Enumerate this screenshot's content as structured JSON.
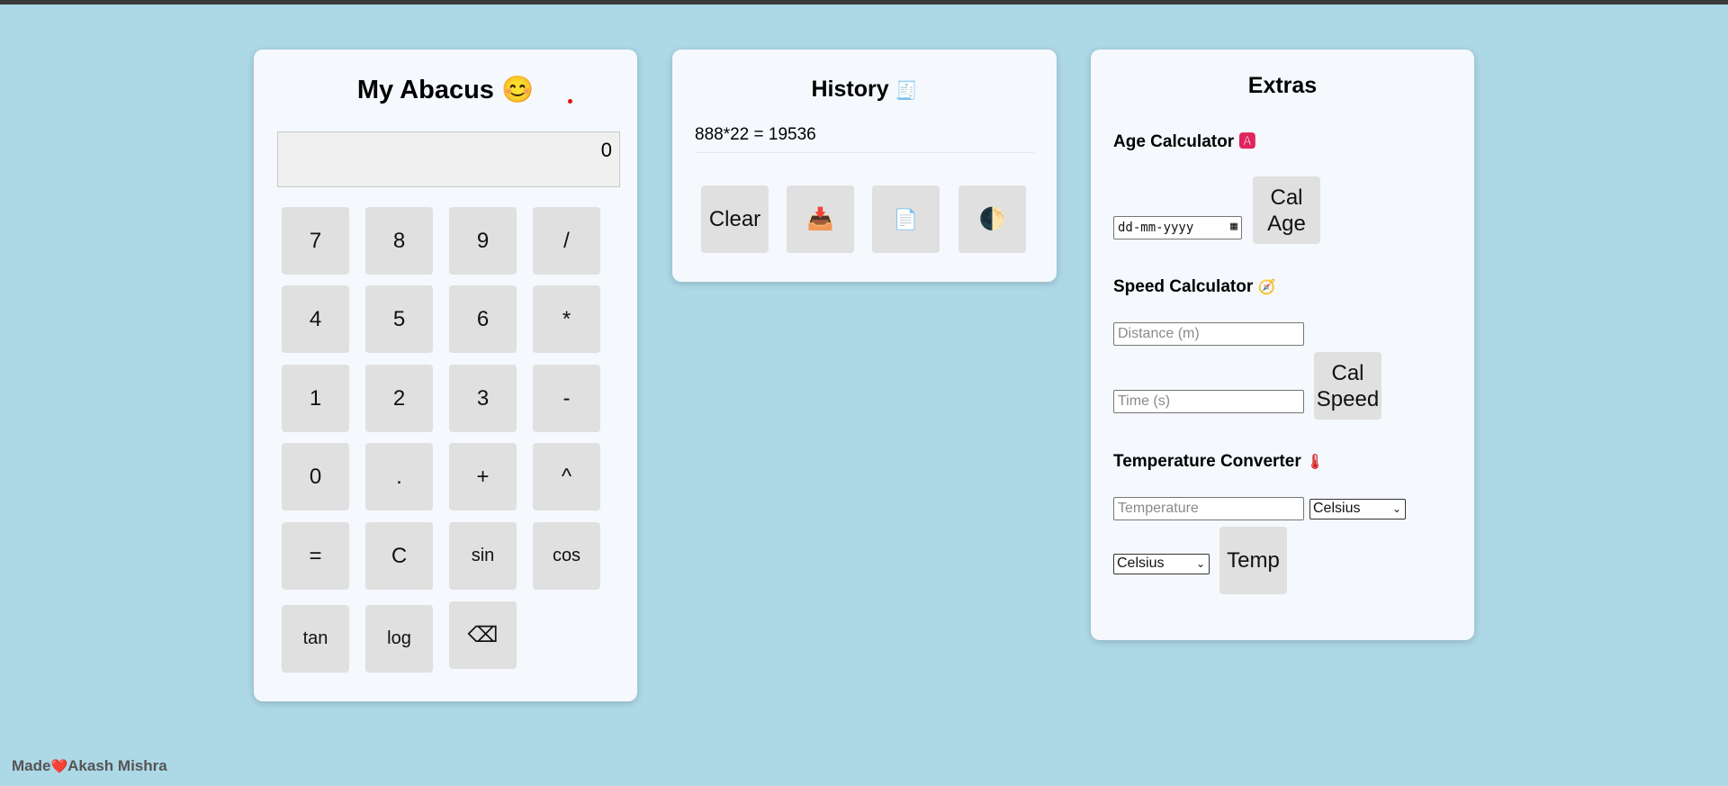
{
  "calculator": {
    "title": "My Abacus",
    "title_emoji": "😊",
    "display_value": "0",
    "keys": [
      "7",
      "8",
      "9",
      "/",
      "4",
      "5",
      "6",
      "*",
      "1",
      "2",
      "3",
      "-",
      "0",
      ".",
      "+",
      "^",
      "=",
      "C",
      "sin",
      "cos",
      "tan",
      "log",
      "⌫"
    ]
  },
  "history": {
    "title": "History",
    "title_icon": "🧾",
    "entries": [
      "888*22 = 19536"
    ],
    "clear_label": "Clear",
    "download_icon": "📥",
    "document_icon": "📄",
    "theme_icon": "🌓"
  },
  "extras": {
    "title": "Extras",
    "age": {
      "title": "Age Calculator",
      "icon": "🅰",
      "date_placeholder": "dd-mm-yyyy",
      "button": "Cal Age"
    },
    "speed": {
      "title": "Speed Calculator",
      "icon": "🧭",
      "distance_placeholder": "Distance (m)",
      "time_placeholder": "Time (s)",
      "button": "Cal Speed"
    },
    "temp": {
      "title": "Temperature Converter",
      "icon": "🌡",
      "input_placeholder": "Temperature",
      "from_unit": "Celsius",
      "to_unit": "Celsius",
      "button": "Temp"
    }
  },
  "footer": {
    "made": "Made",
    "heart": "❤️",
    "author": "Akash Mishra"
  }
}
